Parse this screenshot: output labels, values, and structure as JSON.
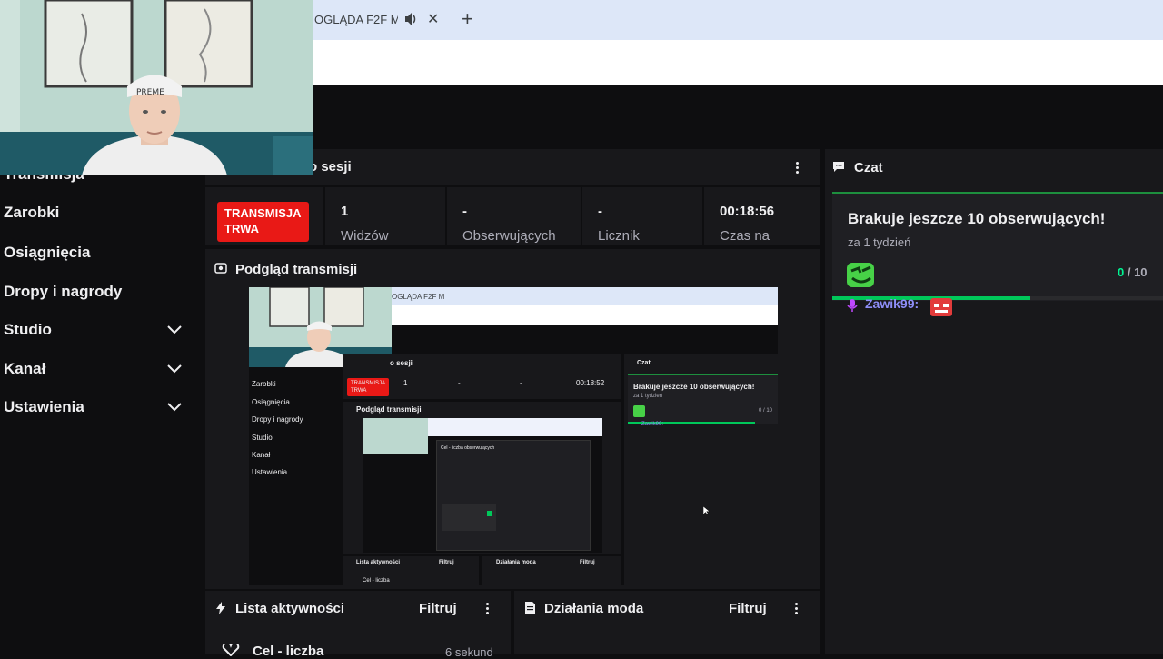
{
  "browser": {
    "tab_title": "OGLĄDA F2F M",
    "tab_close_glyph": "✕",
    "tab_new_glyph": "+"
  },
  "sidebar": {
    "items": [
      {
        "label": "Transmisja"
      },
      {
        "label": "Zarobki"
      },
      {
        "label": "Osiągnięcia"
      },
      {
        "label": "Dropy i nagrody"
      },
      {
        "label": "Studio",
        "expandable": true
      },
      {
        "label": "Kanał",
        "expandable": true
      },
      {
        "label": "Ustawienia",
        "expandable": true
      }
    ]
  },
  "session": {
    "header": "o sesji",
    "live_badge": "TRANSMISJA TRWA",
    "stats": [
      {
        "value": "1",
        "label": "Widzów"
      },
      {
        "value": "-",
        "label": "Obserwujących"
      },
      {
        "value": "-",
        "label": "Licznik"
      },
      {
        "value": "00:18:56",
        "label": "Czas na"
      }
    ]
  },
  "preview": {
    "header": "Podgląd transmisji",
    "mini": {
      "tab_title": "OGLĄDA F2F M",
      "sidebar": [
        "Transmisja",
        "Zarobki",
        "Osiągnięcia",
        "Dropy i nagrody",
        "Studio",
        "Kanał",
        "Ustawienia"
      ],
      "session_header": "o sesji",
      "live_badge": "TRANSMISJA TRWA",
      "stats": [
        "1",
        "-",
        "-",
        "00:18:52"
      ],
      "stat_labels": [
        "Widzów",
        "Obserwujących",
        "Licznik",
        "Czas na"
      ],
      "preview_header": "Podgląd transmisji",
      "chat_header": "Czat",
      "goal_title": "Brakuje jeszcze 10 obserwujących!",
      "goal_time": "za 1 tydzień",
      "goal_count": "0 / 10",
      "chat_user": "Zawik99:",
      "activity_header": "Lista aktywności",
      "filter": "Filtruj",
      "mod_header": "Działania moda",
      "activity_item": "Cel - liczba",
      "activity_time": "2 sekundy",
      "dialog_title": "Cel - liczba obserwujących"
    }
  },
  "chat": {
    "header": "Czat",
    "goal": {
      "title": "Brakuje jeszcze 10 obserwujących!",
      "time": "za 1 tydzień",
      "current": "0",
      "total": " / 10",
      "progress": 0.6
    },
    "message_user": "Zawik99:"
  },
  "activity": {
    "header": "Lista aktywności",
    "filter": "Filtruj",
    "items": [
      {
        "label": "Cel - liczba",
        "time": "6 sekund"
      }
    ]
  },
  "mod": {
    "header": "Działania moda",
    "filter": "Filtruj"
  },
  "colors": {
    "accent_green": "#00f593",
    "live_red": "#e91916",
    "panel": "#18181b",
    "background": "#0e0e10"
  }
}
